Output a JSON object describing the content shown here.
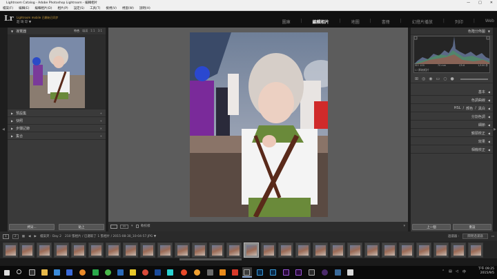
{
  "window": {
    "title": "Lightroom Catalog - Adobe Photoshop Lightroom - 編輯相片",
    "ctrl": [
      "—",
      "□",
      "✕"
    ]
  },
  "menu": [
    "檔案(F)",
    "編輯(E)",
    "編輯相片(D)",
    "相片(P)",
    "設定(S)",
    "工具(T)",
    "檢視(V)",
    "視窗(W)",
    "說明(H)"
  ],
  "identity": {
    "logo": "Lr",
    "line1": "Lightroom mobile 已開始已同步",
    "line2": "莊 琦 琮 ▼"
  },
  "modules": [
    {
      "label": "圖庫"
    },
    {
      "label": "編輯相片",
      "active": true
    },
    {
      "label": "地圖"
    },
    {
      "label": "書冊"
    },
    {
      "label": "幻燈片播放"
    },
    {
      "label": "列印"
    },
    {
      "label": "Web"
    }
  ],
  "left": {
    "navigator": {
      "title": "導覽器",
      "zooms": [
        "符合",
        "填滿",
        "1:1",
        "3:1"
      ]
    },
    "sections": [
      "預設集",
      "快照",
      "步驟記錄",
      "集合"
    ],
    "buttons": {
      "copy": "拷貝...",
      "paste": "貼上"
    }
  },
  "right": {
    "histogram": {
      "title": "色階分佈圖",
      "info": [
        "ISO 100",
        "70 mm",
        "f/5.6",
        "1/100 秒"
      ],
      "original": "原始相片"
    },
    "sections": [
      "基本",
      "色調曲線",
      "HSL / 顏色 / 黑白",
      "分割色調",
      "細節",
      "鏡頭校正",
      "效果",
      "相機校正"
    ],
    "hsl_parts": [
      "HSL",
      "/",
      "顏色",
      "/",
      "黑白"
    ],
    "buttons": {
      "prev": "上一個",
      "reset": "重設"
    }
  },
  "toolbar": {
    "softproof": "軟校樣"
  },
  "filmstrip": {
    "pages": [
      "1",
      "2"
    ],
    "path": "檔案夾 : Day 2",
    "count": "210 張相片 / 已選取了 1 張相片 / 2015-08-30_10-04-57.JPG ▼",
    "filter_label": "過濾器 :",
    "filter_value": "關閉過濾器"
  },
  "clock": {
    "time": "下午 09:25",
    "date": "2015/9/5"
  }
}
